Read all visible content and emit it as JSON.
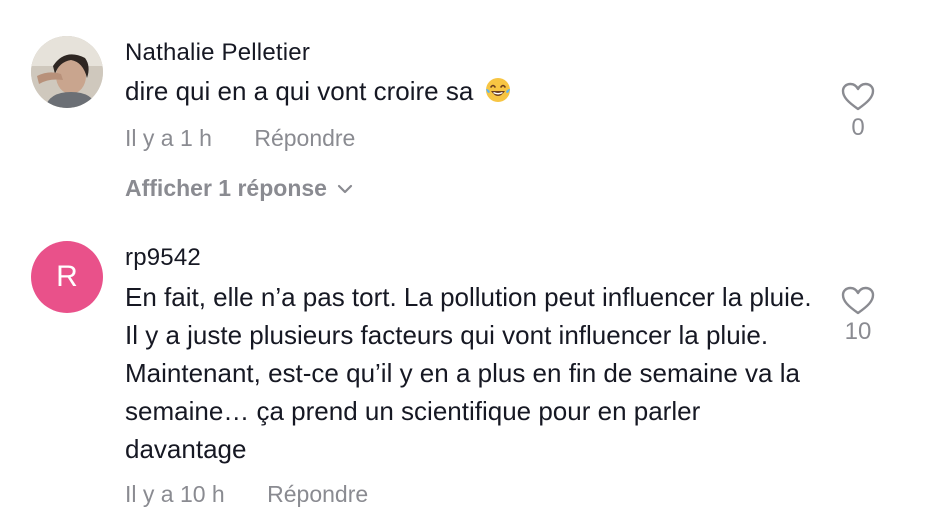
{
  "comments": [
    {
      "username": "Nathalie Pelletier",
      "text": "dire qui en a qui vont croire sa",
      "emoji": "laughing-tears-emoji",
      "time": "Il y a 1 h",
      "reply_label": "Répondre",
      "view_replies_label": "Afficher 1 réponse",
      "like_count": "0",
      "avatar_type": "photo"
    },
    {
      "username": "rp9542",
      "avatar_letter": "R",
      "avatar_color": "#e9518a",
      "text": "En fait, elle n’a pas tort. La pollution peut influencer la pluie. Il y a juste plusieurs facteurs qui vont influencer la pluie. Maintenant, est-ce qu’il y en a plus en fin de semaine va la semaine… ça prend un scientifique pour en parler davantage",
      "time": "Il y a 10 h",
      "reply_label": "Répondre",
      "like_count": "10"
    }
  ],
  "icons": {
    "like": "heart-outline-icon",
    "expand": "chevron-down-icon"
  },
  "colors": {
    "text": "#161823",
    "secondary": "#8a8b91"
  }
}
